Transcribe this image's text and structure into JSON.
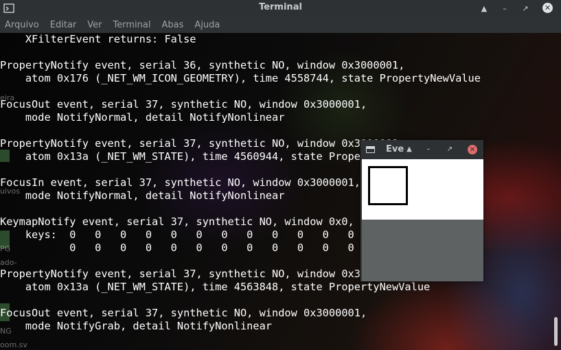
{
  "titlebar": {
    "title": "Terminal",
    "icon": "terminal-icon",
    "buttons": [
      "restore-up-icon",
      "minimize-icon",
      "maximize-icon",
      "close-icon"
    ]
  },
  "menubar": [
    "Arquivo",
    "Editar",
    "Ver",
    "Terminal",
    "Abas",
    "Ajuda"
  ],
  "terminal": {
    "lines": [
      "    XFilterEvent returns: False",
      "",
      "PropertyNotify event, serial 36, synthetic NO, window 0x3000001,",
      "    atom 0x176 (_NET_WM_ICON_GEOMETRY), time 4558744, state PropertyNewValue",
      "",
      "FocusOut event, serial 37, synthetic NO, window 0x3000001,",
      "    mode NotifyNormal, detail NotifyNonlinear",
      "",
      "PropertyNotify event, serial 37, synthetic NO, window 0x3000001,",
      "    atom 0x13a (_NET_WM_STATE), time 4560944, state PropertyNewValue",
      "",
      "FocusIn event, serial 37, synthetic NO, window 0x3000001,",
      "    mode NotifyNormal, detail NotifyNonlinear",
      "",
      "KeymapNotify event, serial 37, synthetic NO, window 0x0,",
      "    keys:  0   0   0   0   0   0   0   0   0   0   0   0   0   0   0   0",
      "           0   0   0   0   0   0   0   0   0   0   0   0   0   0   0   0",
      "",
      "PropertyNotify event, serial 37, synthetic NO, window 0x3000001,",
      "    atom 0x13a (_NET_WM_STATE), time 4563848, state PropertyNewValue",
      "",
      "FocusOut event, serial 37, synthetic NO, window 0x3000001,",
      "    mode NotifyGrab, detail NotifyNonlinear"
    ]
  },
  "desktop_labels": [
    "eira",
    "uivos",
    "PG",
    "ado-",
    "NG",
    "oom.sv"
  ],
  "event_window": {
    "title": "Eve",
    "icon": "window-icon",
    "buttons": [
      "restore-up-icon",
      "minimize-icon",
      "maximize-icon",
      "close-icon"
    ]
  }
}
